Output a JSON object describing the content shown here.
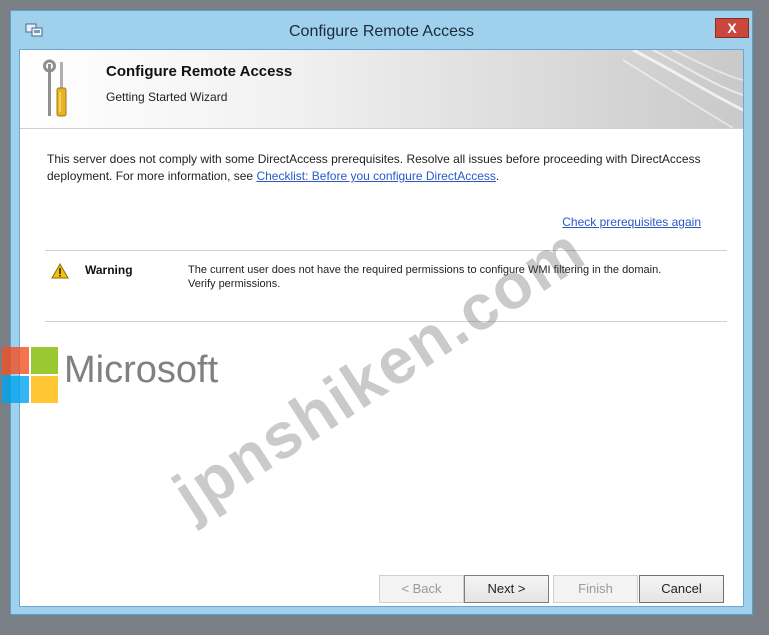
{
  "window": {
    "title": "Configure Remote Access",
    "close_label": "X"
  },
  "banner": {
    "title": "Configure Remote Access",
    "subtitle": "Getting Started Wizard",
    "icon": "wrench-screwdriver-icon"
  },
  "message": {
    "text_before": "This server does not comply with some DirectAccess prerequisites. Resolve all issues before proceeding with DirectAccess deployment. For more information, see ",
    "link": "Checklist: Before you configure DirectAccess",
    "text_after": "."
  },
  "recheck_link": "Check prerequisites again",
  "issues": [
    {
      "level": "Warning",
      "icon": "warning-icon",
      "text": "The current user does not have the required permissions to configure WMI filtering in the domain. Verify permissions."
    }
  ],
  "buttons": {
    "back": "< Back",
    "next": "Next >",
    "finish": "Finish",
    "cancel": "Cancel"
  },
  "watermarks": {
    "brand": "Microsoft",
    "site": "jpnshiken.com"
  },
  "colors": {
    "link": "#2a58c4",
    "close": "#c9473c",
    "frame": "#9fd0ec"
  }
}
